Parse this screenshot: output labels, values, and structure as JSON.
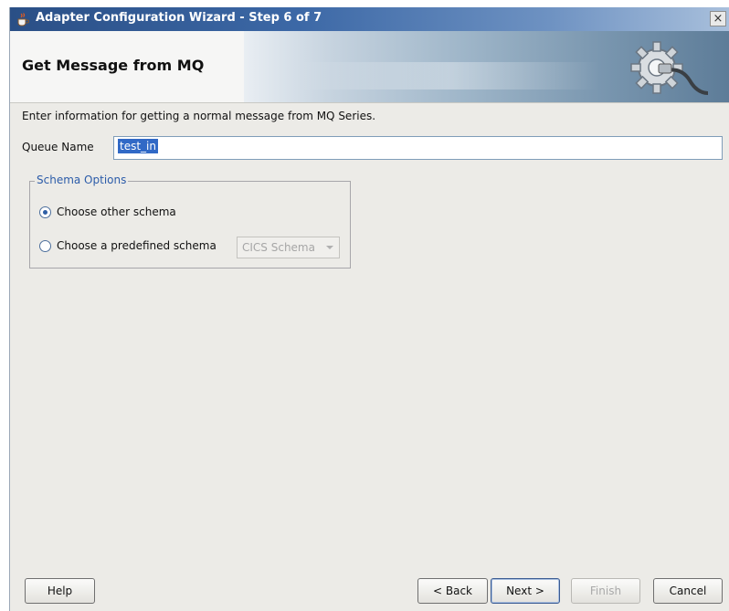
{
  "window": {
    "title": "Adapter Configuration Wizard - Step 6 of 7",
    "close_glyph": "×"
  },
  "banner": {
    "title": "Get Message from MQ",
    "graphic_icon": "gear-plug-icon"
  },
  "form": {
    "instruction": "Enter information for getting a normal message from MQ Series.",
    "queue_name_label": "Queue Name",
    "queue_name_value": "test_in"
  },
  "schema_options": {
    "legend": "Schema Options",
    "options": [
      {
        "label": "Choose other schema",
        "selected": true
      },
      {
        "label": "Choose a predefined schema",
        "selected": false
      }
    ],
    "predefined_select": {
      "value": "CICS Schema",
      "enabled": false
    }
  },
  "buttons": {
    "help": "Help",
    "back": "< Back",
    "next": "Next >",
    "finish": "Finish",
    "cancel": "Cancel"
  },
  "colors": {
    "titlebar": "#2a4f86",
    "selection": "#3169c6",
    "legend_text": "#2c5ca9",
    "dialog_bg": "#ecebe7"
  }
}
